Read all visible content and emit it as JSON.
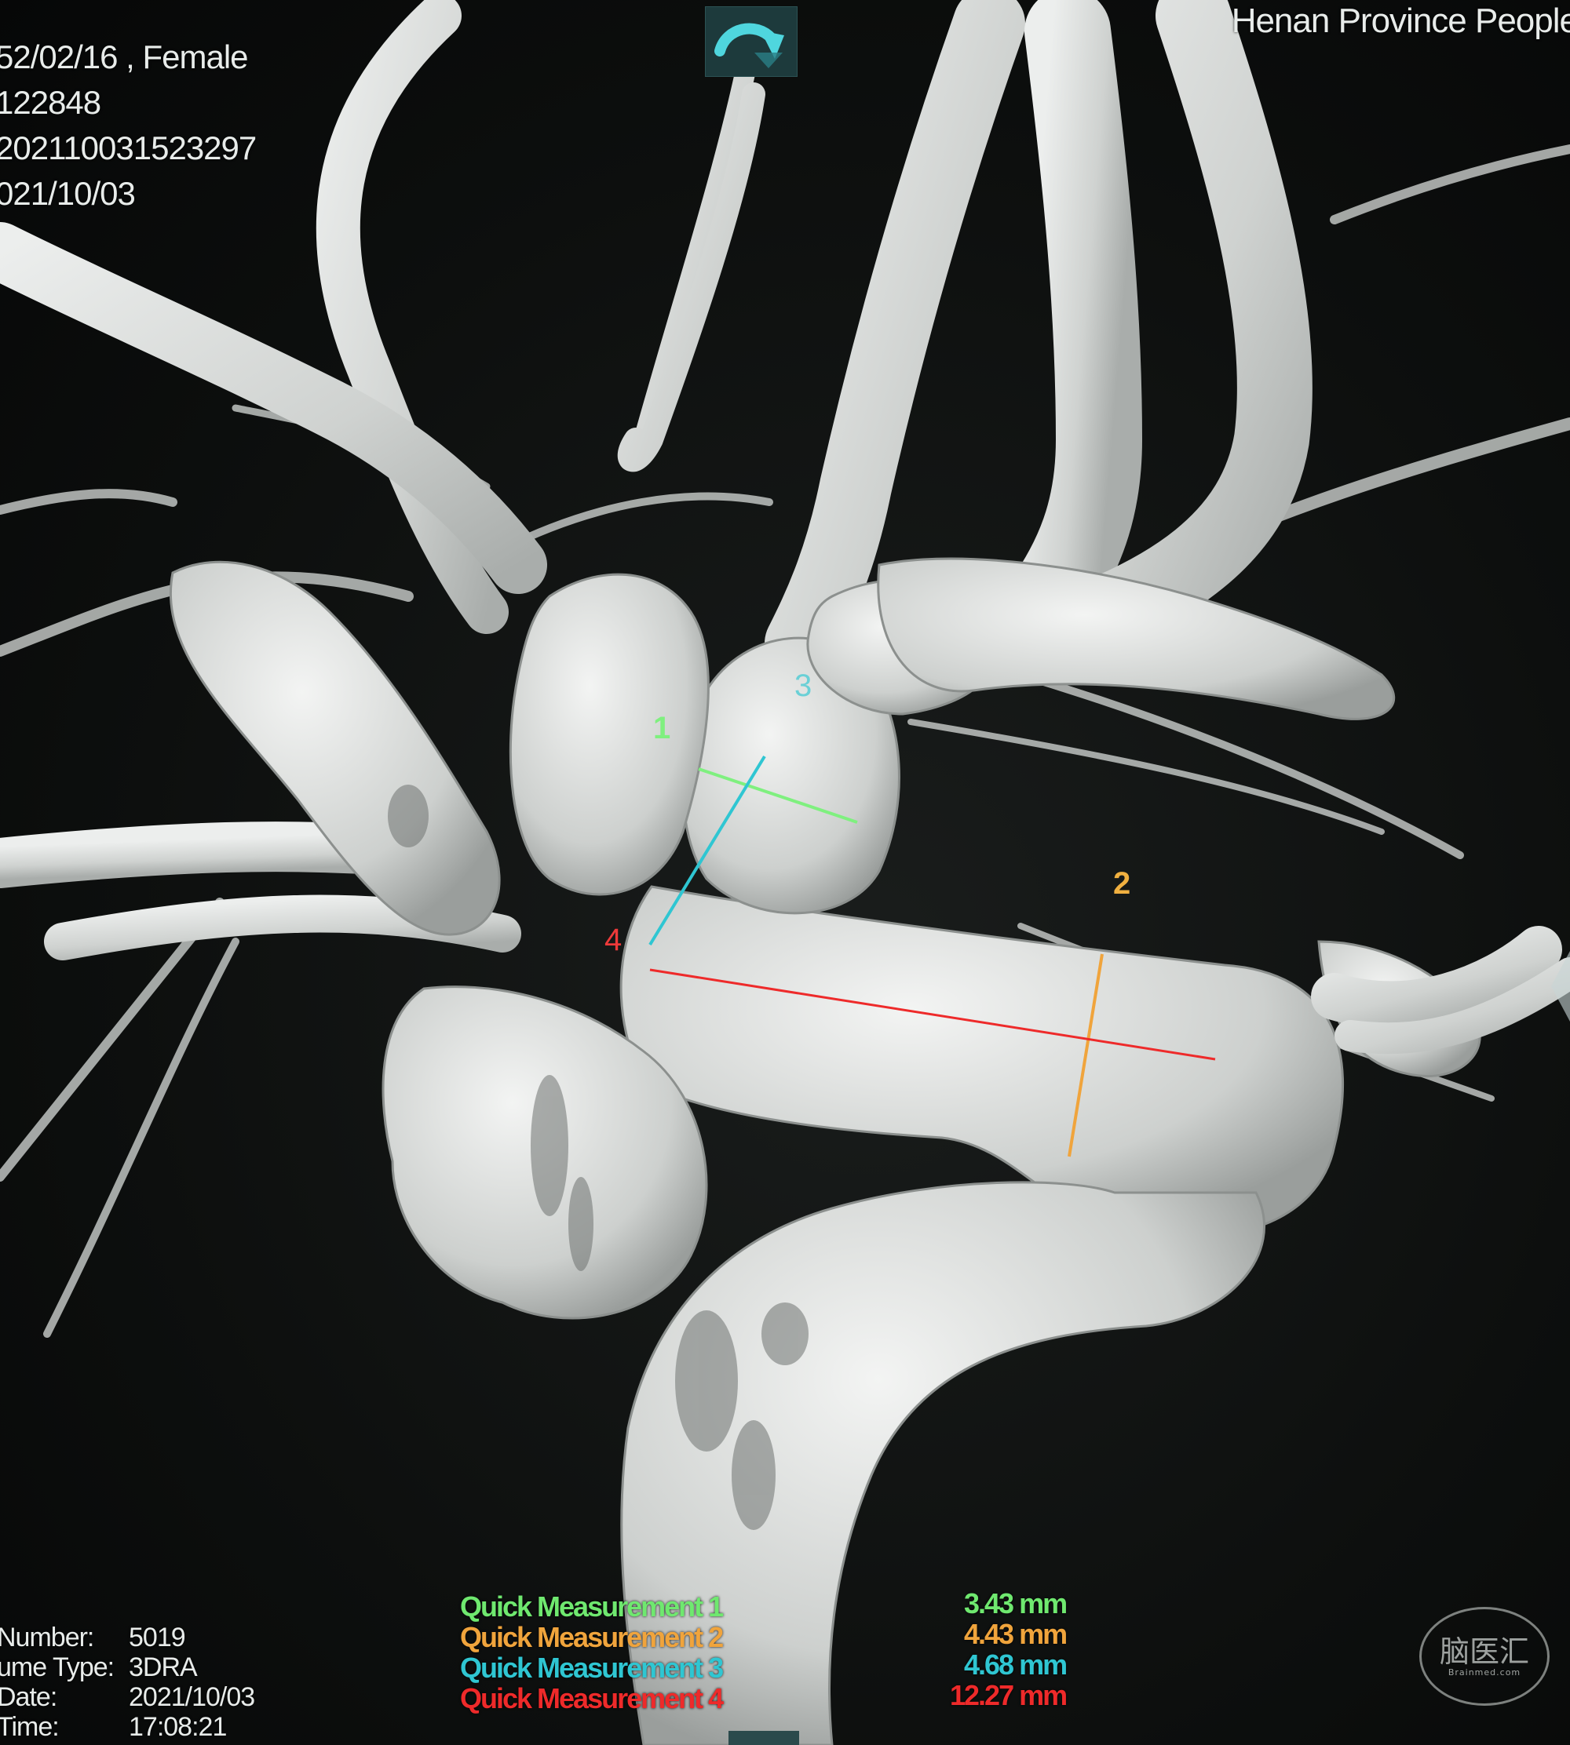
{
  "patient": {
    "birth_sex": "52/02/16 , Female",
    "patient_id": "122848",
    "study_id": "202110031523297",
    "study_date": "021/10/03"
  },
  "institution": "Henan Province People",
  "series": [
    {
      "label": "Number:",
      "value": "5019"
    },
    {
      "label": "ume Type:",
      "value": "3DRA"
    },
    {
      "label": "Date:",
      "value": "2021/10/03"
    },
    {
      "label": "Time:",
      "value": "17:08:21"
    }
  ],
  "measurements": [
    {
      "id": "1",
      "name": "Quick Measurement 1",
      "value": "3.43 mm",
      "color": "#6fe86f"
    },
    {
      "id": "2",
      "name": "Quick Measurement 2",
      "value": "4.43 mm",
      "color": "#f0a43c"
    },
    {
      "id": "3",
      "name": "Quick Measurement 3",
      "value": "4.68 mm",
      "color": "#2fc6d2"
    },
    {
      "id": "4",
      "name": "Quick Measurement 4",
      "value": "12.27 mm",
      "color": "#ee2a2a"
    }
  ],
  "watermark": {
    "main": "脑医汇",
    "sub": "Brainmed.com"
  },
  "icons": {
    "rotate": "rotate-arrow-icon"
  }
}
